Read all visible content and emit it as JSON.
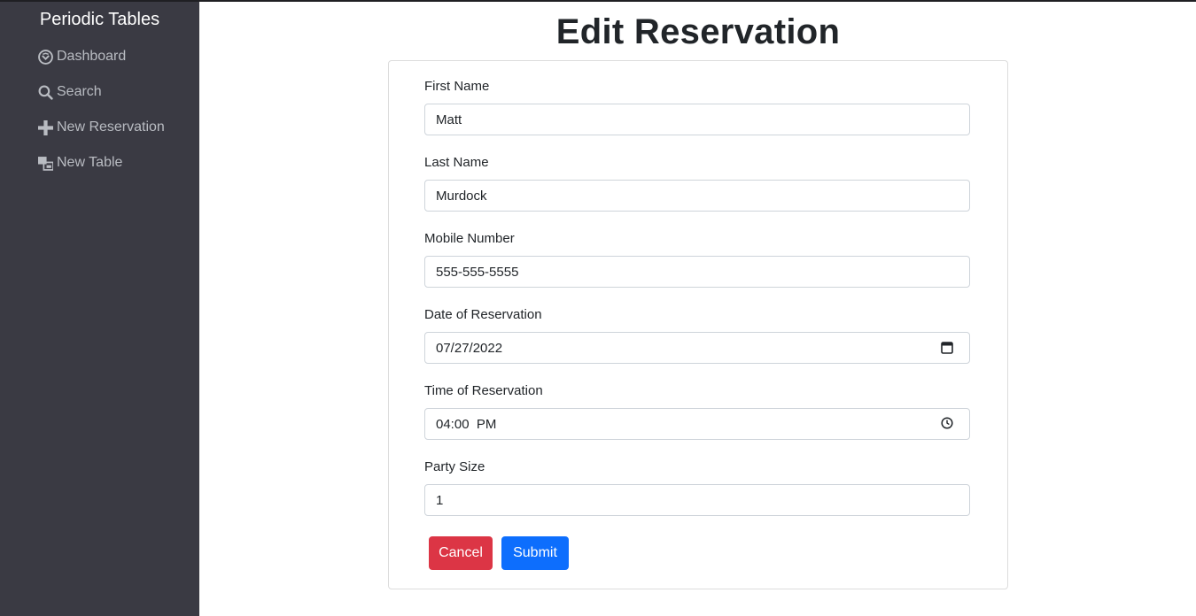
{
  "sidebar": {
    "brand": "Periodic Tables",
    "items": [
      {
        "label": "Dashboard",
        "icon": "dashboard-icon"
      },
      {
        "label": "Search",
        "icon": "search-icon"
      },
      {
        "label": "New Reservation",
        "icon": "plus-icon"
      },
      {
        "label": "New Table",
        "icon": "tables-icon"
      }
    ]
  },
  "page": {
    "title": "Edit Reservation"
  },
  "form": {
    "first_name": {
      "label": "First Name",
      "value": "Matt"
    },
    "last_name": {
      "label": "Last Name",
      "value": "Murdock"
    },
    "mobile_number": {
      "label": "Mobile Number",
      "value": "555-555-5555"
    },
    "reservation_date": {
      "label": "Date of Reservation",
      "value": "07/27/2022",
      "icon": "calendar-icon"
    },
    "reservation_time": {
      "label": "Time of Reservation",
      "value": "04:00  PM",
      "icon": "clock-icon"
    },
    "people": {
      "label": "Party Size",
      "value": "1"
    },
    "cancel_label": "Cancel",
    "submit_label": "Submit"
  },
  "colors": {
    "sidebar_bg": "#3a3a43",
    "cancel": "#dc3545",
    "submit": "#0d6efd"
  }
}
